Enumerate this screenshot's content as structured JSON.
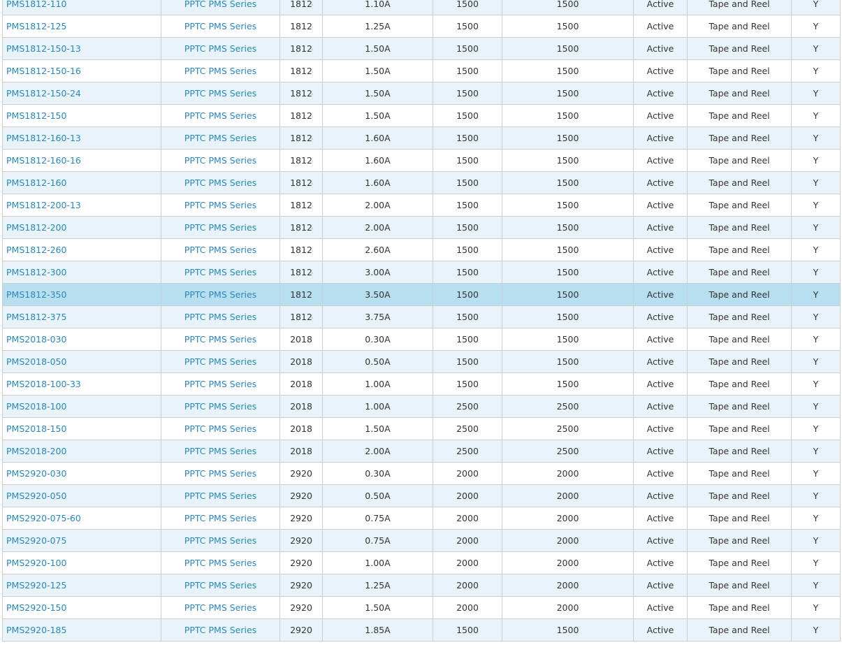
{
  "table": {
    "rows": [
      {
        "part": "PMS1812-110",
        "series": "PPTC PMS Series",
        "size": "1812",
        "current": "1.10A",
        "qty1": "1500",
        "qty2": "1500",
        "status": "Active",
        "packaging": "Tape and Reel",
        "rohs": "Y"
      },
      {
        "part": "PMS1812-125",
        "series": "PPTC PMS Series",
        "size": "1812",
        "current": "1.25A",
        "qty1": "1500",
        "qty2": "1500",
        "status": "Active",
        "packaging": "Tape and Reel",
        "rohs": "Y"
      },
      {
        "part": "PMS1812-150-13",
        "series": "PPTC PMS Series",
        "size": "1812",
        "current": "1.50A",
        "qty1": "1500",
        "qty2": "1500",
        "status": "Active",
        "packaging": "Tape and Reel",
        "rohs": "Y"
      },
      {
        "part": "PMS1812-150-16",
        "series": "PPTC PMS Series",
        "size": "1812",
        "current": "1.50A",
        "qty1": "1500",
        "qty2": "1500",
        "status": "Active",
        "packaging": "Tape and Reel",
        "rohs": "Y"
      },
      {
        "part": "PMS1812-150-24",
        "series": "PPTC PMS Series",
        "size": "1812",
        "current": "1.50A",
        "qty1": "1500",
        "qty2": "1500",
        "status": "Active",
        "packaging": "Tape and Reel",
        "rohs": "Y"
      },
      {
        "part": "PMS1812-150",
        "series": "PPTC PMS Series",
        "size": "1812",
        "current": "1.50A",
        "qty1": "1500",
        "qty2": "1500",
        "status": "Active",
        "packaging": "Tape and Reel",
        "rohs": "Y"
      },
      {
        "part": "PMS1812-160-13",
        "series": "PPTC PMS Series",
        "size": "1812",
        "current": "1.60A",
        "qty1": "1500",
        "qty2": "1500",
        "status": "Active",
        "packaging": "Tape and Reel",
        "rohs": "Y"
      },
      {
        "part": "PMS1812-160-16",
        "series": "PPTC PMS Series",
        "size": "1812",
        "current": "1.60A",
        "qty1": "1500",
        "qty2": "1500",
        "status": "Active",
        "packaging": "Tape and Reel",
        "rohs": "Y"
      },
      {
        "part": "PMS1812-160",
        "series": "PPTC PMS Series",
        "size": "1812",
        "current": "1.60A",
        "qty1": "1500",
        "qty2": "1500",
        "status": "Active",
        "packaging": "Tape and Reel",
        "rohs": "Y"
      },
      {
        "part": "PMS1812-200-13",
        "series": "PPTC PMS Series",
        "size": "1812",
        "current": "2.00A",
        "qty1": "1500",
        "qty2": "1500",
        "status": "Active",
        "packaging": "Tape and Reel",
        "rohs": "Y"
      },
      {
        "part": "PMS1812-200",
        "series": "PPTC PMS Series",
        "size": "1812",
        "current": "2.00A",
        "qty1": "1500",
        "qty2": "1500",
        "status": "Active",
        "packaging": "Tape and Reel",
        "rohs": "Y"
      },
      {
        "part": "PMS1812-260",
        "series": "PPTC PMS Series",
        "size": "1812",
        "current": "2.60A",
        "qty1": "1500",
        "qty2": "1500",
        "status": "Active",
        "packaging": "Tape and Reel",
        "rohs": "Y"
      },
      {
        "part": "PMS1812-300",
        "series": "PPTC PMS Series",
        "size": "1812",
        "current": "3.00A",
        "qty1": "1500",
        "qty2": "1500",
        "status": "Active",
        "packaging": "Tape and Reel",
        "rohs": "Y"
      },
      {
        "part": "PMS1812-350",
        "series": "PPTC PMS Series",
        "size": "1812",
        "current": "3.50A",
        "qty1": "1500",
        "qty2": "1500",
        "status": "Active",
        "packaging": "Tape and Reel",
        "rohs": "Y"
      },
      {
        "part": "PMS1812-375",
        "series": "PPTC PMS Series",
        "size": "1812",
        "current": "3.75A",
        "qty1": "1500",
        "qty2": "1500",
        "status": "Active",
        "packaging": "Tape and Reel",
        "rohs": "Y"
      },
      {
        "part": "PMS2018-030",
        "series": "PPTC PMS Series",
        "size": "2018",
        "current": "0.30A",
        "qty1": "1500",
        "qty2": "1500",
        "status": "Active",
        "packaging": "Tape and Reel",
        "rohs": "Y"
      },
      {
        "part": "PMS2018-050",
        "series": "PPTC PMS Series",
        "size": "2018",
        "current": "0.50A",
        "qty1": "1500",
        "qty2": "1500",
        "status": "Active",
        "packaging": "Tape and Reel",
        "rohs": "Y"
      },
      {
        "part": "PMS2018-100-33",
        "series": "PPTC PMS Series",
        "size": "2018",
        "current": "1.00A",
        "qty1": "1500",
        "qty2": "1500",
        "status": "Active",
        "packaging": "Tape and Reel",
        "rohs": "Y"
      },
      {
        "part": "PMS2018-100",
        "series": "PPTC PMS Series",
        "size": "2018",
        "current": "1.00A",
        "qty1": "2500",
        "qty2": "2500",
        "status": "Active",
        "packaging": "Tape and Reel",
        "rohs": "Y"
      },
      {
        "part": "PMS2018-150",
        "series": "PPTC PMS Series",
        "size": "2018",
        "current": "1.50A",
        "qty1": "2500",
        "qty2": "2500",
        "status": "Active",
        "packaging": "Tape and Reel",
        "rohs": "Y"
      },
      {
        "part": "PMS2018-200",
        "series": "PPTC PMS Series",
        "size": "2018",
        "current": "2.00A",
        "qty1": "2500",
        "qty2": "2500",
        "status": "Active",
        "packaging": "Tape and Reel",
        "rohs": "Y"
      },
      {
        "part": "PMS2920-030",
        "series": "PPTC PMS Series",
        "size": "2920",
        "current": "0.30A",
        "qty1": "2000",
        "qty2": "2000",
        "status": "Active",
        "packaging": "Tape and Reel",
        "rohs": "Y"
      },
      {
        "part": "PMS2920-050",
        "series": "PPTC PMS Series",
        "size": "2920",
        "current": "0.50A",
        "qty1": "2000",
        "qty2": "2000",
        "status": "Active",
        "packaging": "Tape and Reel",
        "rohs": "Y"
      },
      {
        "part": "PMS2920-075-60",
        "series": "PPTC PMS Series",
        "size": "2920",
        "current": "0.75A",
        "qty1": "2000",
        "qty2": "2000",
        "status": "Active",
        "packaging": "Tape and Reel",
        "rohs": "Y"
      },
      {
        "part": "PMS2920-075",
        "series": "PPTC PMS Series",
        "size": "2920",
        "current": "0.75A",
        "qty1": "2000",
        "qty2": "2000",
        "status": "Active",
        "packaging": "Tape and Reel",
        "rohs": "Y"
      },
      {
        "part": "PMS2920-100",
        "series": "PPTC PMS Series",
        "size": "2920",
        "current": "1.00A",
        "qty1": "2000",
        "qty2": "2000",
        "status": "Active",
        "packaging": "Tape and Reel",
        "rohs": "Y"
      },
      {
        "part": "PMS2920-125",
        "series": "PPTC PMS Series",
        "size": "2920",
        "current": "1.25A",
        "qty1": "2000",
        "qty2": "2000",
        "status": "Active",
        "packaging": "Tape and Reel",
        "rohs": "Y"
      },
      {
        "part": "PMS2920-150",
        "series": "PPTC PMS Series",
        "size": "2920",
        "current": "1.50A",
        "qty1": "2000",
        "qty2": "2000",
        "status": "Active",
        "packaging": "Tape and Reel",
        "rohs": "Y"
      },
      {
        "part": "PMS2920-185",
        "series": "PPTC PMS Series",
        "size": "2920",
        "current": "1.85A",
        "qty1": "1500",
        "qty2": "1500",
        "status": "Active",
        "packaging": "Tape and Reel",
        "rohs": "Y"
      }
    ],
    "highlighted_row": 13
  },
  "colors": {
    "link": "#2a87b8",
    "row_alt": "#e8f4fa",
    "row_highlight": "#b8dff0",
    "border": "#c9cfd4",
    "text": "#333333"
  }
}
